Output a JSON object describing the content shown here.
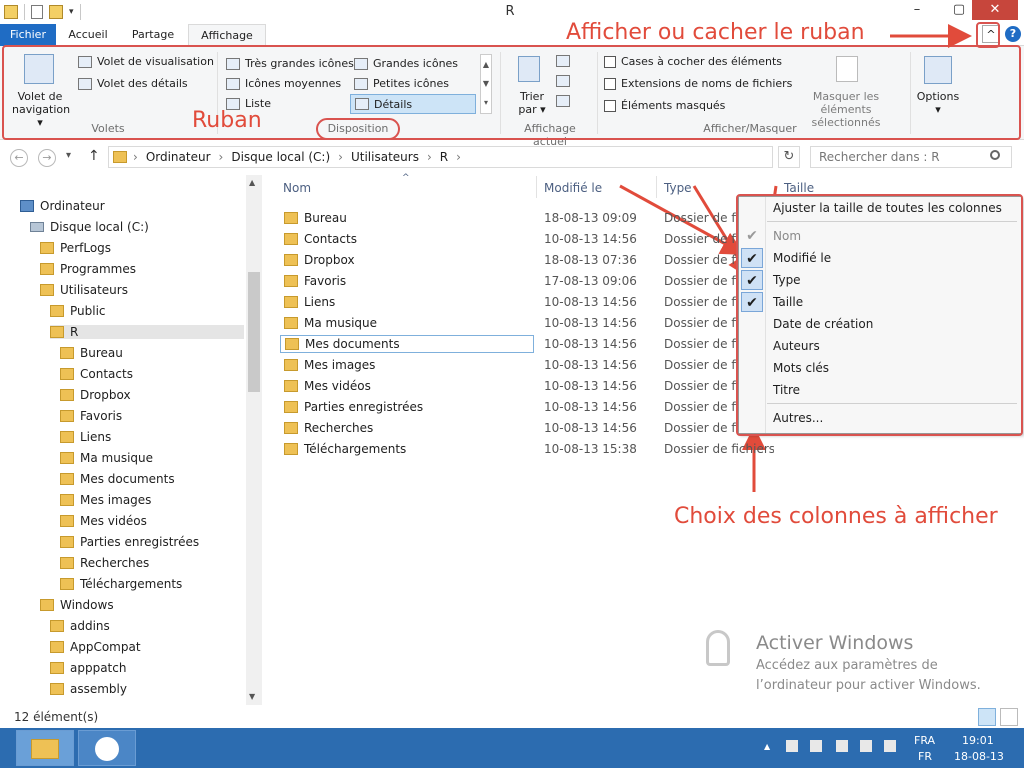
{
  "window": {
    "title": "R"
  },
  "title_controls": {
    "minimize": "–",
    "restore": "▢",
    "close": "✕"
  },
  "tabs": [
    "Fichier",
    "Accueil",
    "Partage",
    "Affichage"
  ],
  "ribbon": {
    "volets": {
      "group_label": "Volets",
      "nav_pane_line1": "Volet de",
      "nav_pane_line2": "navigation ▾",
      "preview": "Volet de visualisation",
      "details": "Volet des détails"
    },
    "disposition": {
      "group_label": "Disposition",
      "items": [
        "Très grandes icônes",
        "Grandes icônes",
        "Icônes moyennes",
        "Petites icônes",
        "Liste",
        "Détails"
      ],
      "selected": "Détails"
    },
    "affichage_actuel": {
      "group_label": "Affichage actuel",
      "sort_line1": "Trier",
      "sort_line2": "par ▾"
    },
    "afficher_masquer": {
      "group_label": "Afficher/Masquer",
      "checkboxes": [
        "Cases à cocher des éléments",
        "Extensions de noms de fichiers",
        "Éléments masqués"
      ],
      "hide_selected_line1": "Masquer les éléments",
      "hide_selected_line2": "sélectionnés"
    },
    "options": {
      "label": "Options",
      "arrow": "▾"
    },
    "collapse_icon": "^",
    "help_icon": "?"
  },
  "annotations": {
    "ribbon": "Ruban",
    "toggle_ribbon": "Afficher ou cacher le ruban",
    "columns_choice": "Choix des colonnes à afficher"
  },
  "address": {
    "back": "←",
    "forward": "→",
    "dropdown": "▾",
    "up": "↑",
    "segments": [
      "Ordinateur",
      "Disque local (C:)",
      "Utilisateurs",
      "R"
    ],
    "separator": "›",
    "refresh": "↻",
    "search_placeholder": "Rechercher dans : R"
  },
  "nav_tree": [
    {
      "label": "Ordinateur",
      "icon": "computer-icon",
      "level": 0
    },
    {
      "label": "Disque local (C:)",
      "icon": "disk-icon",
      "level": 1
    },
    {
      "label": "PerfLogs",
      "icon": "folder-icon",
      "level": 2
    },
    {
      "label": "Programmes",
      "icon": "folder-icon",
      "level": 2
    },
    {
      "label": "Utilisateurs",
      "icon": "folder-icon",
      "level": 2
    },
    {
      "label": "Public",
      "icon": "folder-icon",
      "level": 3
    },
    {
      "label": "R",
      "icon": "folder-icon",
      "level": 3,
      "selected": true
    },
    {
      "label": "Bureau",
      "icon": "folder-icon",
      "level": 4
    },
    {
      "label": "Contacts",
      "icon": "folder-icon",
      "level": 4
    },
    {
      "label": "Dropbox",
      "icon": "folder-icon",
      "level": 4
    },
    {
      "label": "Favoris",
      "icon": "folder-icon",
      "level": 4
    },
    {
      "label": "Liens",
      "icon": "folder-icon",
      "level": 4
    },
    {
      "label": "Ma musique",
      "icon": "folder-icon",
      "level": 4
    },
    {
      "label": "Mes documents",
      "icon": "folder-icon",
      "level": 4
    },
    {
      "label": "Mes images",
      "icon": "folder-icon",
      "level": 4
    },
    {
      "label": "Mes vidéos",
      "icon": "folder-icon",
      "level": 4
    },
    {
      "label": "Parties enregistrées",
      "icon": "folder-icon",
      "level": 4
    },
    {
      "label": "Recherches",
      "icon": "folder-icon",
      "level": 4
    },
    {
      "label": "Téléchargements",
      "icon": "folder-icon",
      "level": 4
    },
    {
      "label": "Windows",
      "icon": "folder-icon",
      "level": 2
    },
    {
      "label": "addins",
      "icon": "folder-icon",
      "level": 3
    },
    {
      "label": "AppCompat",
      "icon": "folder-icon",
      "level": 3
    },
    {
      "label": "apppatch",
      "icon": "folder-icon",
      "level": 3
    },
    {
      "label": "assembly",
      "icon": "folder-icon",
      "level": 3
    }
  ],
  "columns": {
    "name": "Nom",
    "modified": "Modifié le",
    "type": "Type",
    "size": "Taille",
    "sort_arrow": "^"
  },
  "files": [
    {
      "name": "Bureau",
      "modified": "18-08-13 09:09",
      "type": "Dossier de fichiers"
    },
    {
      "name": "Contacts",
      "modified": "10-08-13 14:56",
      "type": "Dossier de fichiers"
    },
    {
      "name": "Dropbox",
      "modified": "18-08-13 07:36",
      "type": "Dossier de fichiers"
    },
    {
      "name": "Favoris",
      "modified": "17-08-13 09:06",
      "type": "Dossier de fichiers"
    },
    {
      "name": "Liens",
      "modified": "10-08-13 14:56",
      "type": "Dossier de fichiers"
    },
    {
      "name": "Ma musique",
      "modified": "10-08-13 14:56",
      "type": "Dossier de fichiers"
    },
    {
      "name": "Mes documents",
      "modified": "10-08-13 14:56",
      "type": "Dossier de fichiers",
      "focused": true
    },
    {
      "name": "Mes images",
      "modified": "10-08-13 14:56",
      "type": "Dossier de fichiers"
    },
    {
      "name": "Mes vidéos",
      "modified": "10-08-13 14:56",
      "type": "Dossier de fichiers"
    },
    {
      "name": "Parties enregistrées",
      "modified": "10-08-13 14:56",
      "type": "Dossier de fichiers"
    },
    {
      "name": "Recherches",
      "modified": "10-08-13 14:56",
      "type": "Dossier de fichiers"
    },
    {
      "name": "Téléchargements",
      "modified": "10-08-13 15:38",
      "type": "Dossier de fichiers"
    }
  ],
  "context_menu": {
    "fit_all": "Ajuster la taille de toutes les colonnes",
    "items": [
      {
        "label": "Nom",
        "checked": true,
        "disabled": true
      },
      {
        "label": "Modifié le",
        "checked": true
      },
      {
        "label": "Type",
        "checked": true
      },
      {
        "label": "Taille",
        "checked": true
      },
      {
        "label": "Date de création",
        "checked": false
      },
      {
        "label": "Auteurs",
        "checked": false
      },
      {
        "label": "Mots clés",
        "checked": false
      },
      {
        "label": "Titre",
        "checked": false
      }
    ],
    "more": "Autres...",
    "check_glyph": "✔"
  },
  "watermark": {
    "title": "Activer Windows",
    "line1": "Accédez aux paramètres de",
    "line2": "l’ordinateur pour activer Windows."
  },
  "status": {
    "count": "12 élément(s)"
  },
  "taskbar": {
    "lang_top": "FRA",
    "lang_bottom": "FR",
    "time": "19:01",
    "date": "18-08-13",
    "tray_arrow": "▲"
  },
  "colors": {
    "accent": "#1f6cc4",
    "annotation": "#e14b3b",
    "taskbar": "#2c6cb0",
    "close": "#c7463c"
  }
}
